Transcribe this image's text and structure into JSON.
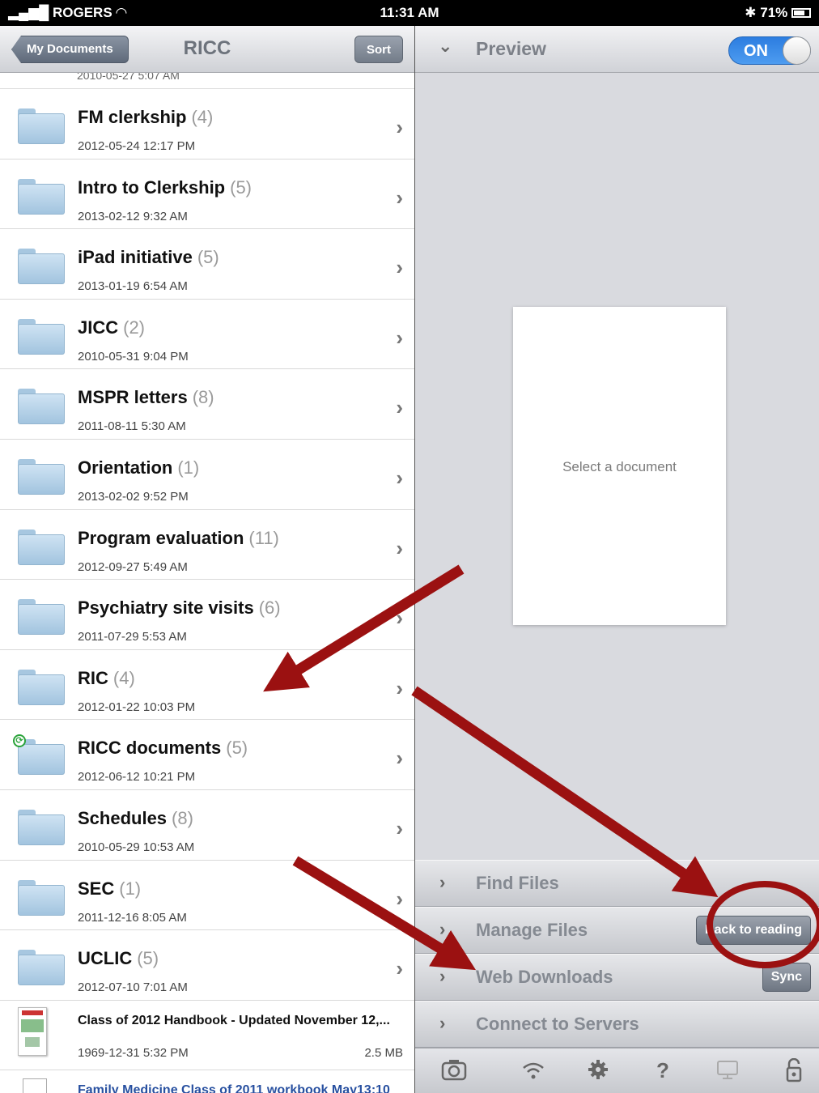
{
  "status_bar": {
    "carrier": "ROGERS",
    "time": "11:31 AM",
    "battery": "71%"
  },
  "left_nav": {
    "back_label": "My Documents",
    "title": "RICC",
    "sort_label": "Sort"
  },
  "list": {
    "peek_text": "2010-05-27 5:07 AM",
    "folders": [
      {
        "name": "FM clerkship",
        "count": "(4)",
        "date": "2012-05-24 12:17 PM"
      },
      {
        "name": "Intro to Clerkship",
        "count": "(5)",
        "date": "2013-02-12 9:32 AM"
      },
      {
        "name": "iPad initiative",
        "count": "(5)",
        "date": "2013-01-19 6:54 AM"
      },
      {
        "name": "JICC",
        "count": "(2)",
        "date": "2010-05-31 9:04 PM"
      },
      {
        "name": "MSPR letters",
        "count": "(8)",
        "date": "2011-08-11 5:30 AM"
      },
      {
        "name": "Orientation",
        "count": "(1)",
        "date": "2013-02-02 9:52 PM"
      },
      {
        "name": "Program evaluation",
        "count": "(11)",
        "date": "2012-09-27 5:49 AM"
      },
      {
        "name": "Psychiatry site visits",
        "count": "(6)",
        "date": "2011-07-29 5:53 AM"
      },
      {
        "name": "RIC",
        "count": "(4)",
        "date": "2012-01-22 10:03 PM"
      },
      {
        "name": "RICC documents",
        "count": "(5)",
        "date": "2012-06-12 10:21 PM"
      },
      {
        "name": "Schedules",
        "count": "(8)",
        "date": "2010-05-29 10:53 AM"
      },
      {
        "name": "SEC",
        "count": "(1)",
        "date": "2011-12-16 8:05 AM"
      },
      {
        "name": "UCLIC",
        "count": "(5)",
        "date": "2012-07-10 7:01 AM"
      }
    ],
    "files": [
      {
        "name": "Class of 2012 Handbook - Updated November 12,...",
        "date": "1969-12-31 5:32 PM",
        "size": "2.5 MB"
      },
      {
        "name": "Family Medicine Class of 2011 workbook May13:10",
        "date": "",
        "size": ""
      }
    ]
  },
  "right_nav": {
    "title": "Preview",
    "toggle_label": "ON"
  },
  "preview": {
    "empty_message": "Select a document"
  },
  "panels": {
    "find_files": "Find Files",
    "manage_files": "Manage Files",
    "back_to_reading": "Back to reading",
    "web_downloads": "Web Downloads",
    "sync": "Sync",
    "connect_servers": "Connect to Servers"
  },
  "toolbar": {
    "icons": [
      "camera-icon",
      "wifi-icon",
      "gear-icon",
      "help-icon",
      "screen-icon",
      "lock-icon"
    ],
    "help_glyph": "?"
  },
  "annotation": {
    "arrow_color": "#9b1111"
  }
}
